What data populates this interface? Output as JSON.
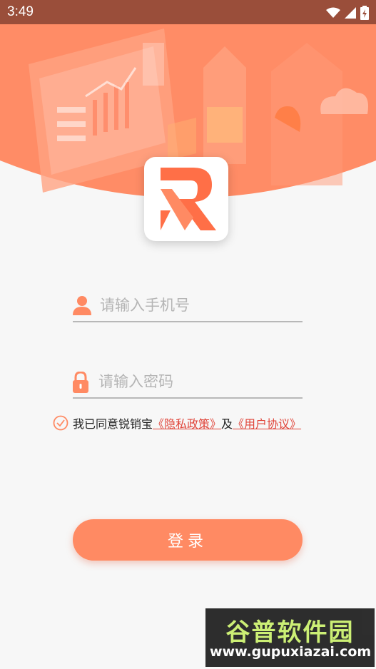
{
  "status_bar": {
    "time": "3:49"
  },
  "app": {
    "logo_letter": "R"
  },
  "login_form": {
    "phone_placeholder": "请输入手机号",
    "phone_value": "",
    "password_placeholder": "请输入密码",
    "password_value": ""
  },
  "agreement": {
    "prefix": "我已同意锐销宝",
    "privacy_link": "《隐私政策》",
    "connector": "及",
    "terms_link": "《用户协议》",
    "checked": true
  },
  "login_button": {
    "label": "登录"
  },
  "watermark": {
    "title": "谷普软件园",
    "url": "www.gupuxiazai.com"
  },
  "colors": {
    "accent": "#ff8a63",
    "header": "#ff8c66",
    "link": "#e0453a",
    "status_bar": "#9a4e3a"
  },
  "icons": {
    "user": "user-icon",
    "lock": "lock-icon",
    "check": "check-circle-icon",
    "wifi": "wifi-icon",
    "signal": "signal-icon",
    "battery": "battery-icon"
  }
}
